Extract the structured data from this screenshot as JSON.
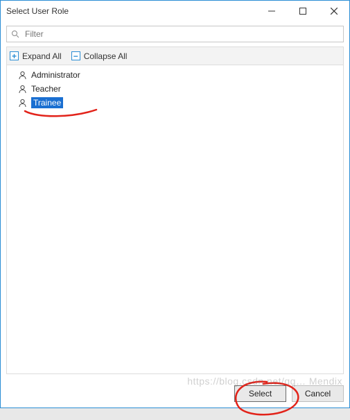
{
  "window": {
    "title": "Select User Role"
  },
  "filter": {
    "placeholder": "Filter",
    "value": ""
  },
  "toolbar": {
    "expand_all": "Expand All",
    "collapse_all": "Collapse All",
    "expand_symbol": "+",
    "collapse_symbol": "−"
  },
  "tree": {
    "items": [
      {
        "label": "Administrator",
        "selected": false
      },
      {
        "label": "Teacher",
        "selected": false
      },
      {
        "label": "Trainee",
        "selected": true
      }
    ]
  },
  "footer": {
    "select": "Select",
    "cancel": "Cancel"
  },
  "watermark": "https://blog.csdn.net/qq… Mendix"
}
